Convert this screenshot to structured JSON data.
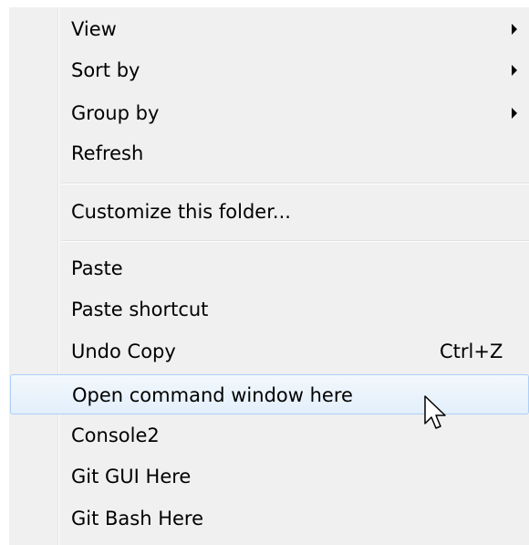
{
  "menu": {
    "items": [
      {
        "label": "View",
        "has_submenu": true
      },
      {
        "label": "Sort by",
        "has_submenu": true
      },
      {
        "label": "Group by",
        "has_submenu": true
      },
      {
        "label": "Refresh"
      },
      {
        "label": "Customize this folder..."
      },
      {
        "label": "Paste"
      },
      {
        "label": "Paste shortcut"
      },
      {
        "label": "Undo Copy",
        "shortcut": "Ctrl+Z"
      },
      {
        "label": "Open command window here",
        "highlighted": true
      },
      {
        "label": "Console2"
      },
      {
        "label": "Git GUI Here"
      },
      {
        "label": "Git Bash Here"
      }
    ]
  },
  "colors": {
    "menu_background": "#f0f0f0",
    "highlight_border": "#aecff7",
    "highlight_fill": "#e3effb",
    "text": "#000000"
  },
  "icons": {
    "submenu_arrow": "triangle-right",
    "cursor": "mouse-pointer-arrow"
  }
}
